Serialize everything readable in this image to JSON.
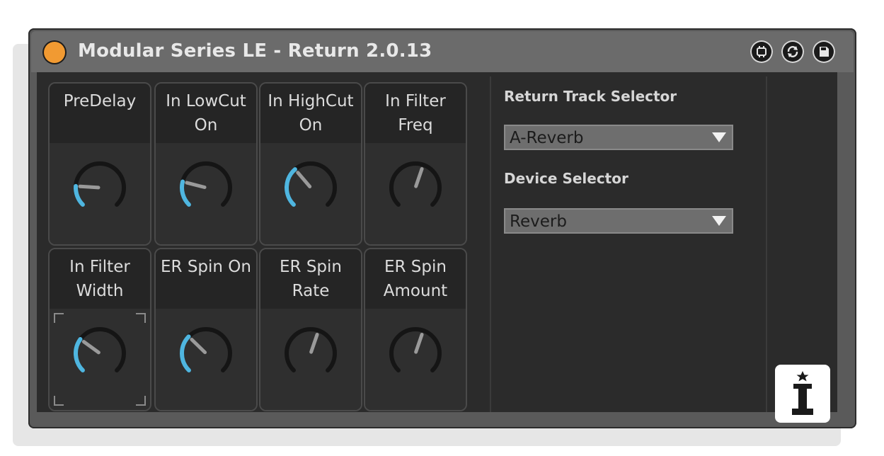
{
  "device": {
    "title": "Modular Series LE - Return 2.0.13"
  },
  "titlebar_buttons": [
    {
      "name": "map-icon"
    },
    {
      "name": "refresh-icon"
    },
    {
      "name": "save-icon"
    }
  ],
  "params": [
    {
      "label": "PreDelay",
      "value": 0.18
    },
    {
      "label": "In LowCut\nOn",
      "value": 0.22
    },
    {
      "label": "In HighCut\nOn",
      "value": 0.35
    },
    {
      "label": "In Filter\nFreq",
      "value": 0.57
    },
    {
      "label": "In Filter\nWidth",
      "value": 0.3
    },
    {
      "label": "ER Spin On",
      "value": 0.33
    },
    {
      "label": "ER Spin\nRate",
      "value": 0.57
    },
    {
      "label": "ER Spin\nAmount",
      "value": 0.57
    }
  ],
  "return_track": {
    "label": "Return Track Selector",
    "value": "A-Reverb"
  },
  "device_selector": {
    "label": "Device Selector",
    "value": "Reverb"
  },
  "colors": {
    "power": "#f19a32",
    "knob_arc": "#4fb6e0",
    "knob_ring": "#151515",
    "knob_needle": "#9a9a9a"
  }
}
